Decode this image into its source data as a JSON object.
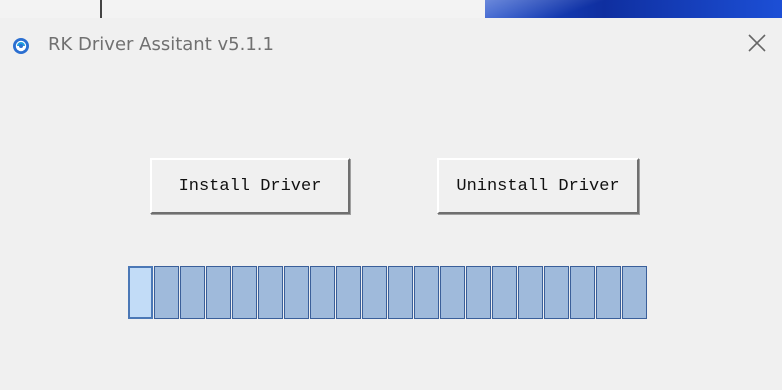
{
  "window": {
    "title": "RK Driver Assitant v5.1.1",
    "icon": "rk-app-icon",
    "close_icon": "close-icon"
  },
  "buttons": {
    "install_label": "Install Driver",
    "uninstall_label": "Uninstall Driver"
  },
  "progress": {
    "segments_total": 20,
    "highlighted_segment": 1
  },
  "colors": {
    "window_bg": "#f0f0f0",
    "segment_fill": "#9fbadb",
    "segment_highlight": "#c2dcf7",
    "segment_border": "#3a5f9a"
  }
}
